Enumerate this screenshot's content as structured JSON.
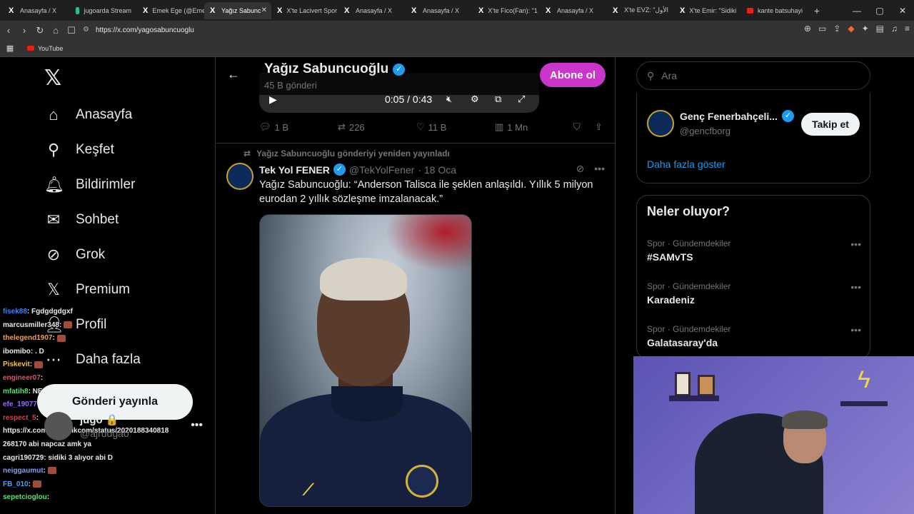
{
  "browser": {
    "tabs": [
      {
        "label": "Anasayfa / X",
        "fav": "x"
      },
      {
        "label": "jugoarda Stream",
        "fav": "y"
      },
      {
        "label": "Emek Ege (@Eme",
        "fav": "x"
      },
      {
        "label": "Yağız Sabunc",
        "fav": "x",
        "active": true
      },
      {
        "label": "X'te Lacivert Spor",
        "fav": "x"
      },
      {
        "label": "Anasayfa / X",
        "fav": "x"
      },
      {
        "label": "Anasayfa / X",
        "fav": "x"
      },
      {
        "label": "X'te Fico(Fan): \"1",
        "fav": "x"
      },
      {
        "label": "Anasayfa / X",
        "fav": "x"
      },
      {
        "label": "X'te EVZ: \"الأول",
        "fav": "x"
      },
      {
        "label": "X'te Emir: \"Sidiki",
        "fav": "x"
      },
      {
        "label": "kante batsuhayi",
        "fav": "r"
      }
    ],
    "url": "https://x.com/yagosabuncuoglu",
    "bookmark": "YouTube"
  },
  "nav": {
    "items": [
      "Anasayfa",
      "Keşfet",
      "Bildirimler",
      "Sohbet",
      "Grok",
      "Premium",
      "Profil",
      "Daha fazla"
    ],
    "post_button": "Gönderi yayınla",
    "profile_name": "jugo 🔒",
    "profile_handle": "@ajrudgao"
  },
  "chat": [
    {
      "user": "fisek88",
      "color": "#3b82f6",
      "msg": ": Fgdgdgdgxf"
    },
    {
      "user": "marcusmiller348",
      "color": "#e7e9ea",
      "msg": ":"
    },
    {
      "user": "thelegend1907",
      "color": "#f0a050",
      "msg": ":"
    },
    {
      "user": "ibomibo",
      "color": "#e7e9ea",
      "msg": ": . D"
    },
    {
      "user": "Piskevit",
      "color": "#f5c542",
      "msg": ":"
    },
    {
      "user": "engineer07",
      "color": "#e0506a",
      "msg": ":"
    },
    {
      "user": "mfatih8",
      "color": "#5ee07a",
      "msg": ": NESYRİ 6 alıyodu"
    },
    {
      "user": "efe_1907777",
      "color": "#9b6bff",
      "msg": ":"
    },
    {
      "user": "respect_5",
      "color": "#e04040",
      "msg": ":"
    },
    {
      "user": "",
      "color": "#e7e9ea",
      "msg": "https://x.com/yeniacikcom/status/2020188340818"
    },
    {
      "user": "",
      "color": "#e7e9ea",
      "msg": "268170 abi napcaz amk ya"
    },
    {
      "user": "cagri190729",
      "color": "#e7e9ea",
      "msg": ": sidiki 3 alıyor abi D"
    },
    {
      "user": "neiggaumut",
      "color": "#7a9cff",
      "msg": ":"
    },
    {
      "user": "FB_010",
      "color": "#4aa3ff",
      "msg": ":"
    },
    {
      "user": "sepetcioglou",
      "color": "#5ee07a",
      "msg": ":"
    }
  ],
  "header": {
    "name": "Yağız Sabuncuoğlu",
    "count": "45 B gönderi",
    "subscribe": "Abone ol",
    "video_time": "0:05 / 0:43"
  },
  "actions": {
    "replies": "1 B",
    "reposts": "226",
    "likes": "11 B",
    "views": "1 Mn"
  },
  "tweet": {
    "repost_note": "Yağız Sabuncuoğlu gönderiyi yeniden yayınladı",
    "name": "Tek Yol FENER",
    "handle": "@TekYolFener",
    "date": "· 18 Oca",
    "text": "Yağız Sabuncuoğlu: “Anderson Talisca ile şeklen anlaşıldı. Yıllık 5 milyon eurodan 2 yıllık sözleşme imzalanacak.”"
  },
  "right": {
    "search_placeholder": "Ara",
    "suggest_name": "Genç Fenerbahçeli...",
    "suggest_handle": "@gencfborg",
    "follow": "Takip et",
    "show_more": "Daha fazla göster",
    "trends_title": "Neler oluyor?",
    "trends": [
      {
        "category": "Spor · Gündemdekiler",
        "name": "#SAMvTS"
      },
      {
        "category": "Spor · Gündemdekiler",
        "name": "Karadeniz"
      },
      {
        "category": "Spor · Gündemdekiler",
        "name": "Galatasaray'da"
      }
    ]
  }
}
